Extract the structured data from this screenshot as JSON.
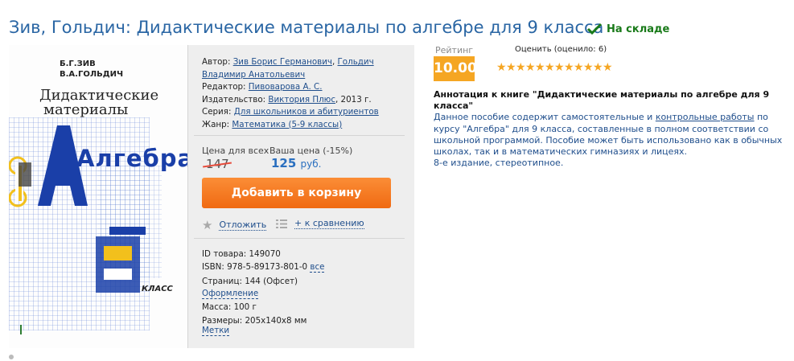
{
  "product": {
    "title": "Зив, Гольдич: Дидактические материалы по алгебре для 9 класса",
    "stock": "На складе"
  },
  "cover": {
    "authors_line1": "Б.Г.ЗИВ",
    "authors_line2": "В.А.ГОЛЬДИЧ",
    "title_line1": "Дидактические",
    "title_line2": "материалы",
    "subject": "Алгебра",
    "grade": "9",
    "grade_word": "КЛАСС"
  },
  "meta": {
    "author_label": "Автор:",
    "author1": "Зив Борис Германович",
    "author2": "Гольдич Владимир Анатольевич",
    "editor_label": "Редактор:",
    "editor": "Пивоварова А. С.",
    "publisher_label": "Издательство:",
    "publisher": "Виктория Плюс",
    "year": ", 2013 г.",
    "series_label": "Серия:",
    "series": "Для школьников и абитуриентов",
    "genre_label": "Жанр:",
    "genre": "Математика (5-9 классы)"
  },
  "price": {
    "all_label": "Цена для всех",
    "your_label": "Ваша цена (-15%)",
    "old": "147",
    "new": "125",
    "currency": "руб."
  },
  "actions": {
    "cart": "Добавить в корзину",
    "postpone": "Отложить",
    "compare": "+ к сравнению"
  },
  "specs": {
    "id": "ID товара: 149070",
    "isbn": "ISBN: 978-5-89173-801-0",
    "isbn_all": "все",
    "pages": "Страниц: 144 (Офсет)",
    "design": "Оформление",
    "weight": "Масса: 100 г",
    "dims": "Размеры: 205x140x8 мм",
    "tags": "Метки"
  },
  "rating": {
    "label": "Рейтинг",
    "value": "10.00",
    "rate_label": "Оценить (оценило: 6)",
    "stars": 10
  },
  "annotation": {
    "heading": "Аннотация к книге \"Дидактические материалы по алгебре для 9 класса\"",
    "text1": "Данное пособие содержит самостоятельные и ",
    "link": "контрольные работы",
    "text2": " по курсу \"Алгебра\" для 9 класса, составленные в полном соответствии со школьной программой. Пособие может быть использовано как в обычных школах, так и в математических гимназиях и лицеях.",
    "text3": "8-е издание, стереотипное."
  },
  "colors": {
    "title": "#2a66a4",
    "stock": "#197a19",
    "button": "#f07a22",
    "rating_bg": "#f5a623",
    "link": "#1f4e8c"
  }
}
